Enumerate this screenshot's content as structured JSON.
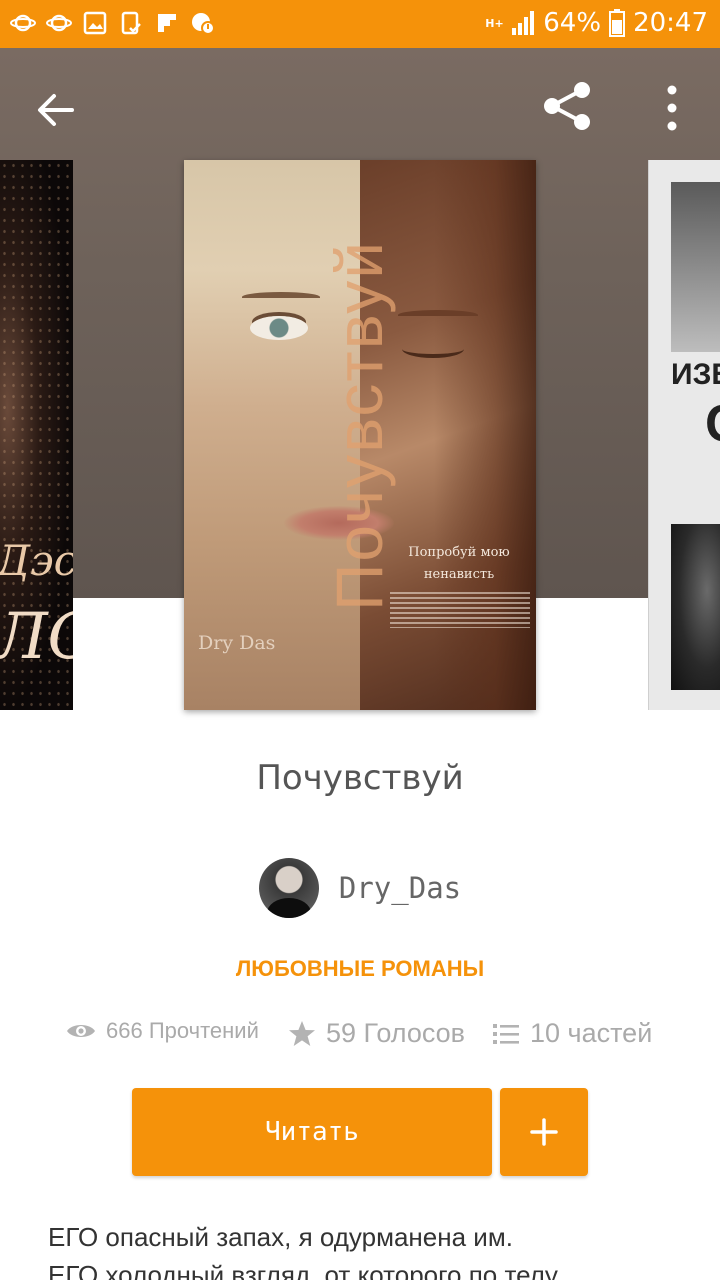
{
  "status_bar": {
    "network_label": "H+",
    "battery": "64%",
    "time": "20:47",
    "left_icons": [
      "saturn-icon",
      "saturn-icon",
      "image-icon",
      "clipboard-check-icon",
      "flipboard-icon",
      "notification-dot-icon"
    ],
    "background": "#f5920a"
  },
  "toolbar": {
    "back_icon": "arrow-left-icon",
    "share_icon": "share-icon",
    "more_icon": "more-vertical-icon"
  },
  "carousel": {
    "left_cover": {
      "script_line1": "Дэс",
      "script_line2": "ЛО"
    },
    "main_cover": {
      "title": "Почувствуй",
      "tagline_line1": "Попробуй мою",
      "tagline_line2": "ненависть",
      "author": "Dry Das"
    },
    "right_cover": {
      "line1": "ИЗБ",
      "line2": "С"
    }
  },
  "book": {
    "title": "Почувствуй",
    "author": "Dry_Das",
    "genre": "ЛЮБОВНЫЕ РОМАНЫ"
  },
  "stats": {
    "reads": "666 Прочтений",
    "votes": "59 Голосов",
    "parts": "10 частей"
  },
  "actions": {
    "read_label": "Читать",
    "add_label": "+"
  },
  "description": {
    "line1": "ЕГО опасный запах, я одурманена им.",
    "line2": "ЕГО холодный взгляд, от которого по телу"
  },
  "colors": {
    "accent": "#f5920a",
    "stat_gray": "#aaaaaa",
    "title_gray": "#555555"
  }
}
